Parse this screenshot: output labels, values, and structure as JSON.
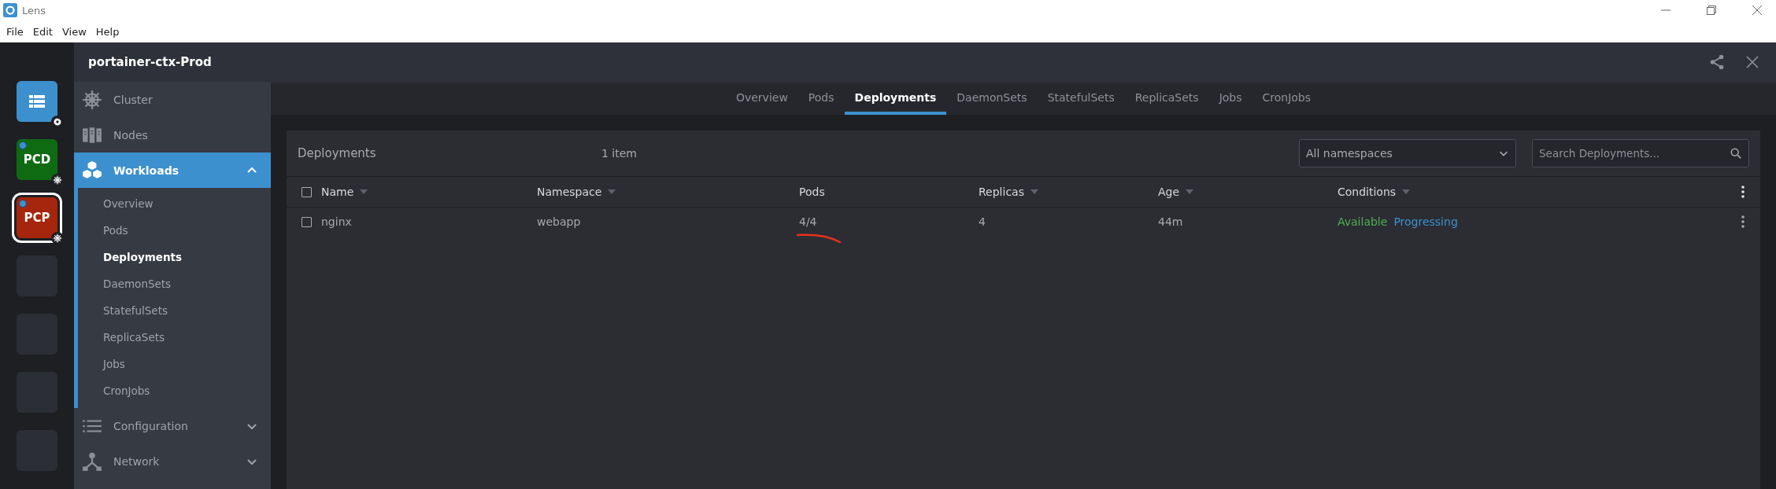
{
  "window": {
    "title": "Lens"
  },
  "menu_bar": [
    "File",
    "Edit",
    "View",
    "Help"
  ],
  "header": {
    "title": "portainer-ctx-Prod"
  },
  "cluster_rail": [
    {
      "kind": "settings",
      "selected": false
    },
    {
      "kind": "cluster",
      "label": "PCD",
      "color": "#0f6b12",
      "selected": false
    },
    {
      "kind": "cluster",
      "label": "PCP",
      "color": "#a5260c",
      "selected": true
    },
    {
      "kind": "empty"
    },
    {
      "kind": "empty"
    },
    {
      "kind": "empty"
    },
    {
      "kind": "empty"
    }
  ],
  "sidebar": {
    "items": [
      {
        "label": "Cluster",
        "kind": "helm",
        "selected": false
      },
      {
        "label": "Nodes",
        "kind": "nodes",
        "selected": false
      },
      {
        "label": "Workloads",
        "kind": "cubes",
        "selected": true,
        "expanded": true,
        "children": [
          {
            "label": "Overview",
            "selected": false
          },
          {
            "label": "Pods",
            "selected": false
          },
          {
            "label": "Deployments",
            "selected": true
          },
          {
            "label": "DaemonSets",
            "selected": false
          },
          {
            "label": "StatefulSets",
            "selected": false
          },
          {
            "label": "ReplicaSets",
            "selected": false
          },
          {
            "label": "Jobs",
            "selected": false
          },
          {
            "label": "CronJobs",
            "selected": false
          }
        ]
      },
      {
        "label": "Configuration",
        "kind": "list",
        "selected": false,
        "expanded": false
      },
      {
        "label": "Network",
        "kind": "network",
        "selected": false,
        "expanded": false
      }
    ]
  },
  "tabs": [
    {
      "label": "Overview",
      "selected": false
    },
    {
      "label": "Pods",
      "selected": false
    },
    {
      "label": "Deployments",
      "selected": true
    },
    {
      "label": "DaemonSets",
      "selected": false
    },
    {
      "label": "StatefulSets",
      "selected": false
    },
    {
      "label": "ReplicaSets",
      "selected": false
    },
    {
      "label": "Jobs",
      "selected": false
    },
    {
      "label": "CronJobs",
      "selected": false
    }
  ],
  "panel": {
    "title": "Deployments",
    "count": "1 item",
    "namespace_select": "All namespaces",
    "search": {
      "placeholder": "Search Deployments..."
    }
  },
  "table": {
    "select_all_checked": false,
    "columns": [
      {
        "label": "Name",
        "sortable": true
      },
      {
        "label": "Namespace",
        "sortable": true
      },
      {
        "label": "Pods",
        "sortable": false
      },
      {
        "label": "Replicas",
        "sortable": true
      },
      {
        "label": "Age",
        "sortable": true
      },
      {
        "label": "Conditions",
        "sortable": true
      }
    ],
    "rows": [
      {
        "checked": false,
        "cells": [
          "nginx",
          "webapp",
          "4/4",
          "4",
          "44m"
        ],
        "conditions": [
          {
            "label": "Available",
            "color": "#4caf50"
          },
          {
            "label": "Progressing",
            "color": "#3d90ce"
          }
        ]
      }
    ]
  }
}
